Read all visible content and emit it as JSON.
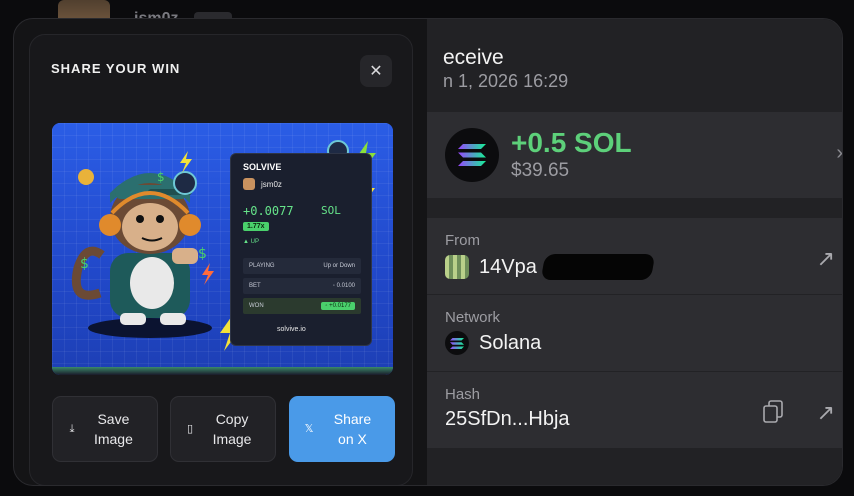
{
  "background": {
    "username": "jsm0z"
  },
  "receive": {
    "title": "eceive",
    "date": "n 1, 2026 16:29",
    "amount": "+0.5 SOL",
    "usd": "$39.65",
    "from_label": "From",
    "from_value": "14Vpa",
    "network_label": "Network",
    "network_value": "Solana",
    "hash_label": "Hash",
    "hash_value": "25SfDn...Hbja"
  },
  "modal": {
    "title": "SHARE YOUR WIN",
    "close_icon": "close-icon",
    "card": {
      "brand": "SOLVIVE",
      "user": "jsm0z",
      "amount": "+0.0077",
      "currency": "SOL",
      "multiplier": "1.77x",
      "direction": "▲ UP",
      "playing_label": "PLAYING",
      "playing_value": "Up or Down",
      "bet_label": "BET",
      "bet_value": "◦ 0.0100",
      "won_label": "WON",
      "won_value": "◦ +0.0177",
      "site": "solvive.io"
    },
    "buttons": {
      "save": "Save Image",
      "copy": "Copy Image",
      "share": "Share on X"
    }
  },
  "colors": {
    "accent": "#4a9ae8",
    "positive": "#5dd07a",
    "panel": "#2d2d31"
  }
}
